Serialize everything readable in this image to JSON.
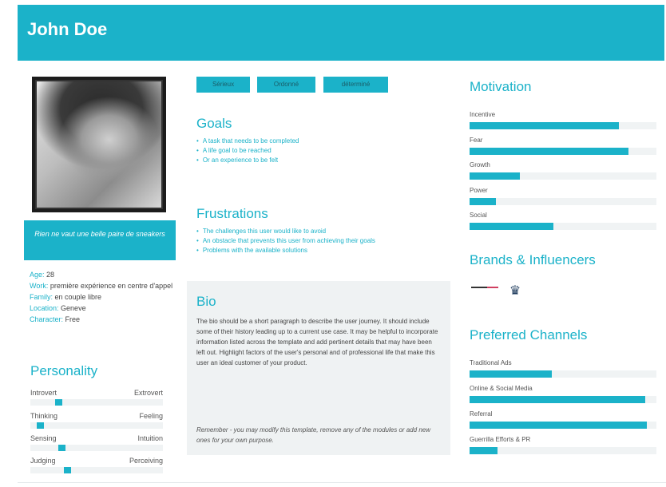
{
  "header": {
    "name": "John Doe"
  },
  "profile": {
    "quote": "Rien ne vaut une belle paire de sneakers",
    "details": [
      {
        "key": "Age:",
        "value": "28"
      },
      {
        "key": "Work:",
        "value": "première expérience en centre d'appel"
      },
      {
        "key": "Family:",
        "value": "en couple libre"
      },
      {
        "key": "Location:",
        "value": "Geneve"
      },
      {
        "key": "Character:",
        "value": "Free"
      }
    ]
  },
  "personality": {
    "title": "Personality",
    "scales": [
      {
        "left": "Introvert",
        "right": "Extrovert",
        "value": 0.2
      },
      {
        "left": "Thinking",
        "right": "Feeling",
        "value": 0.05
      },
      {
        "left": "Sensing",
        "right": "Intuition",
        "value": 0.22
      },
      {
        "left": "Judging",
        "right": "Perceiving",
        "value": 0.27
      }
    ]
  },
  "tags": [
    "Sérieux",
    "Ordonné",
    "déterminé"
  ],
  "goals": {
    "title": "Goals",
    "items": [
      "A task that needs to be completed",
      "A life goal to be reached",
      "Or an experience to be felt"
    ]
  },
  "frustrations": {
    "title": "Frustrations",
    "items": [
      "The challenges this user would like to avoid",
      "An obstacle that prevents this user from achieving their goals",
      "Problems with the available solutions"
    ]
  },
  "bio": {
    "title": "Bio",
    "text": "The bio should be a short paragraph to describe the user journey. It should include some of their history leading up to a current use case. It may be helpful to incorporate information listed across the template and add pertinent details that may have been left out. Highlight factors of the user's personal and of professional life that make this user an ideal customer of your product.",
    "remember": "Remember - you may modify this template, remove any of the modules or add new ones for your own purpose."
  },
  "motivation": {
    "title": "Motivation",
    "items": [
      {
        "label": "Incentive",
        "value": 0.8
      },
      {
        "label": "Fear",
        "value": 0.85
      },
      {
        "label": "Growth",
        "value": 0.27
      },
      {
        "label": "Power",
        "value": 0.14
      },
      {
        "label": "Social",
        "value": 0.45
      }
    ]
  },
  "brands": {
    "title": "Brands & Influencers",
    "icons": [
      "brand-line-logo",
      "brand-figure-logo"
    ]
  },
  "channels": {
    "title": "Preferred Channels",
    "items": [
      {
        "label": "Traditional Ads",
        "value": 0.44
      },
      {
        "label": "Online & Social Media",
        "value": 0.94
      },
      {
        "label": "Referral",
        "value": 0.95
      },
      {
        "label": "Guerrilla Efforts & PR",
        "value": 0.15
      }
    ]
  },
  "colors": {
    "accent": "#1bb2c9",
    "panel": "#eff2f3",
    "track": "#f0f3f4"
  }
}
